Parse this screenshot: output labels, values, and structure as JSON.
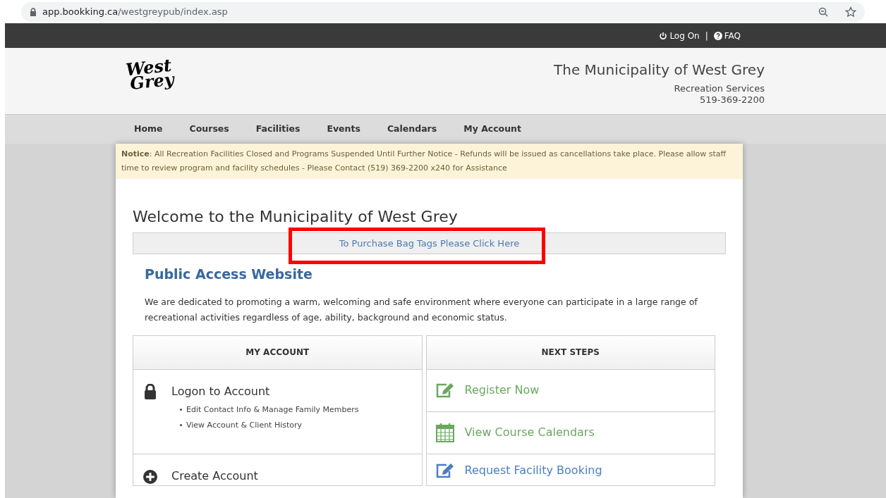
{
  "browser": {
    "url_host": "app.bookking.ca",
    "url_path": "/westgreypub/index.asp"
  },
  "top_bar": {
    "links": [
      {
        "kind": "power",
        "label": "Log On"
      },
      {
        "kind": "help",
        "label": "FAQ"
      }
    ],
    "separator": "|"
  },
  "header": {
    "logo": {
      "line1": "West",
      "line2": "Grey"
    },
    "title": "The Municipality of West Grey",
    "subtitle": "Recreation Services",
    "phone": "519-369-2200"
  },
  "nav": [
    {
      "label": "Home"
    },
    {
      "label": "Courses"
    },
    {
      "label": "Facilities"
    },
    {
      "label": "Events"
    },
    {
      "label": "Calendars"
    },
    {
      "label": "My Account"
    }
  ],
  "notice": {
    "text": "**Notice**: All Recreation Facilities Closed and Programs Suspended Until Further Notice - Refunds will be issued as cancellations take place. Please allow staff time to review program and facility schedules - Please Contact (519) 369-2200 x240 for Assistance"
  },
  "welcome": {
    "title": "Welcome to the Municipality of West Grey",
    "link": "To Purchase Bag Tags Please Click Here",
    "highlighted": true
  },
  "intro": {
    "heading": "Public Access Website",
    "text": "We are dedicated to promoting a warm, welcoming and safe environment where everyone can participate in a large range of recreational activities regardless of age, ability, background and economic status."
  },
  "my_account": {
    "heading": "MY ACCOUNT",
    "items": [
      {
        "kind": "lock",
        "title": "Logon to Account",
        "bullets": [
          "Edit Contact Info & Manage Family Members",
          "View Account & Client History"
        ]
      },
      {
        "kind": "plus",
        "title": "Create Account"
      }
    ]
  },
  "next_steps": {
    "heading": "NEXT STEPS",
    "items": [
      {
        "kind": "edit",
        "title": "Register Now",
        "color": "#6aa85f"
      },
      {
        "kind": "calendar",
        "title": "View Course Calendars",
        "color": "#6aa85f"
      },
      {
        "kind": "edit",
        "title": "Request Facility Booking",
        "color": "#4a7fc1"
      }
    ]
  }
}
